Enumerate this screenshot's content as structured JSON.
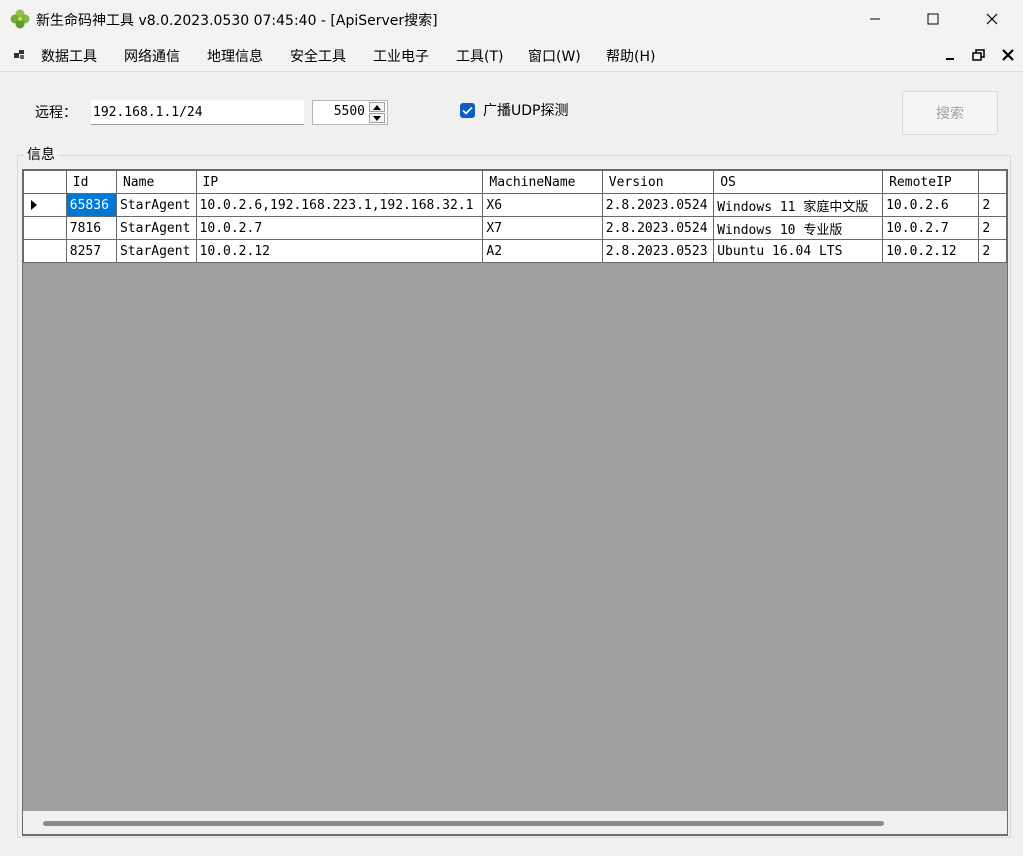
{
  "window": {
    "title": "新生命码神工具 v8.0.2023.0530 07:45:40 - [ApiServer搜索]"
  },
  "menu": {
    "items": [
      "数据工具",
      "网络通信",
      "地理信息",
      "安全工具",
      "工业电子",
      "工具(T)",
      "窗口(W)",
      "帮助(H)"
    ]
  },
  "form": {
    "remote_label": "远程：",
    "remote_value": "192.168.1.1/24",
    "port_value": "5500",
    "broadcast_label": "广播UDP探测",
    "broadcast_checked": true,
    "search_label": "搜索",
    "group_label": "信息"
  },
  "grid": {
    "columns": [
      "Id",
      "Name",
      "IP",
      "MachineName",
      "Version",
      "OS",
      "RemoteIP",
      ""
    ],
    "rows": [
      [
        "65836",
        "StarAgent",
        "10.0.2.6,192.168.223.1,192.168.32.1",
        "X6",
        "2.8.2023.0524",
        "Windows 11 家庭中文版",
        "10.0.2.6",
        "2"
      ],
      [
        "7816",
        "StarAgent",
        "10.0.2.7",
        "X7",
        "2.8.2023.0524",
        "Windows 10 专业版",
        "10.0.2.7",
        "2"
      ],
      [
        "8257",
        "StarAgent",
        "10.0.2.12",
        "A2",
        "2.8.2023.0523",
        "Ubuntu 16.04 LTS",
        "10.0.2.12",
        "2"
      ]
    ],
    "selected_row": 0
  },
  "colors": {
    "accent": "#0078d7",
    "grid_background": "#a0a0a0",
    "checkbox": "#0a5fc2"
  },
  "icons": {
    "app": "clover-icon",
    "minimize": "minimize-icon",
    "maximize": "maximize-icon",
    "close": "close-icon"
  }
}
